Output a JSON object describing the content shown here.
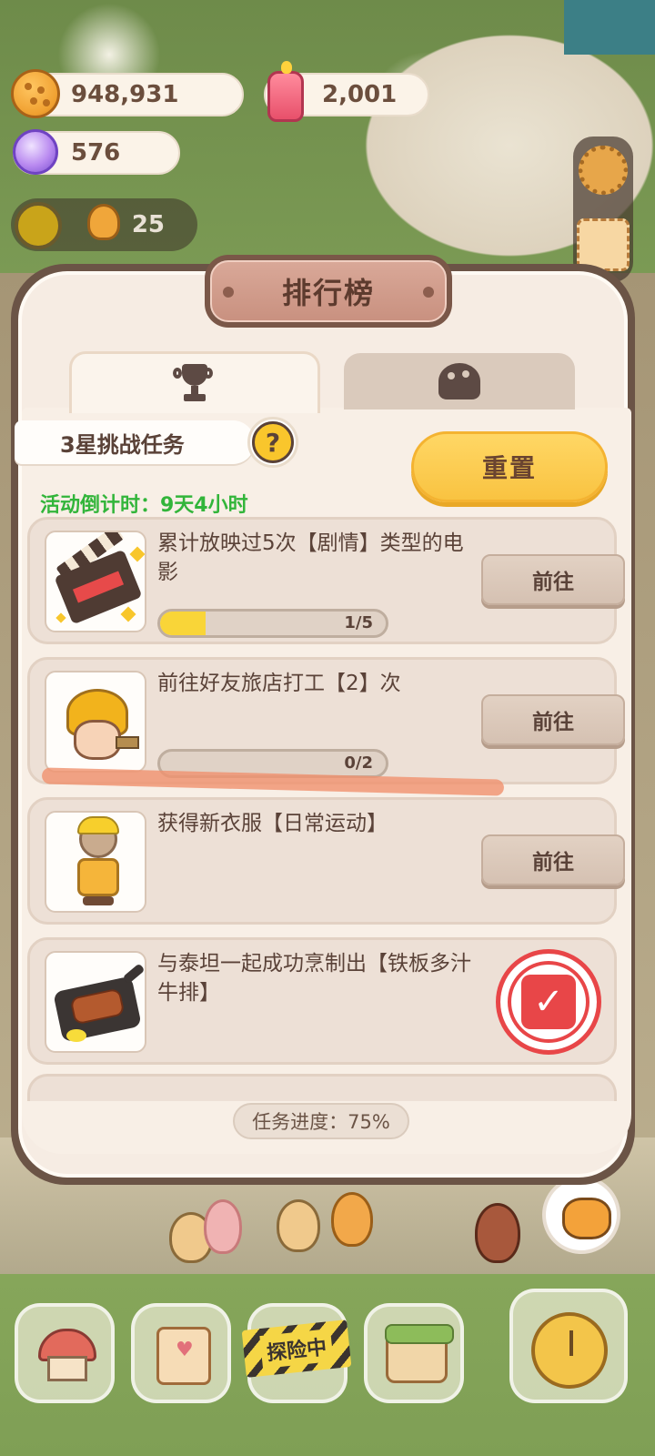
{
  "currencies": {
    "coins": "948,931",
    "candles": "2,001",
    "crystals": "576"
  },
  "player_level": {
    "value": "25"
  },
  "panel": {
    "title": "排行榜",
    "tabs": [
      {
        "icon": "trophy-icon",
        "active": true
      },
      {
        "icon": "cookie-icon",
        "active": false
      }
    ],
    "challenge_label": "3星挑战任务",
    "help_label": "?",
    "countdown": "活动倒计时：9天4小时",
    "reset_button": "重置",
    "tasks": [
      {
        "title": "累计放映过5次【剧情】类型的电影",
        "progress_text": "1/5",
        "progress": 0.2,
        "button": "前往",
        "thumb": "film-clapper-icon"
      },
      {
        "title": "前往好友旅店打工【2】次",
        "progress_text": "0/2",
        "progress": 0,
        "button": "前往",
        "thumb": "worker-character-icon"
      },
      {
        "title": "获得新衣服【日常运动】",
        "button": "前往",
        "thumb": "outfit-doll-icon"
      },
      {
        "title": "与泰坦一起成功烹制出【铁板多汁牛排】",
        "status": "completed",
        "thumb": "steak-dish-icon"
      }
    ],
    "overall_progress": "任务进度：75%"
  },
  "bottom_nav": {
    "explore_tag": "探险中"
  },
  "colors": {
    "accent_yellow": "#f9c341",
    "text_brown": "#5a4238",
    "countdown_green": "#32b53a",
    "done_red": "#e84648",
    "panel_frame": "#6b5446"
  }
}
